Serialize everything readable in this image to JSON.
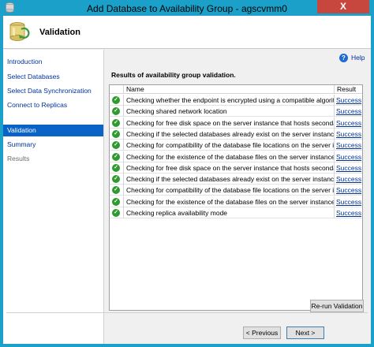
{
  "window": {
    "title": "Add Database to Availability Group - agscvmm0",
    "close_glyph": "X"
  },
  "header": {
    "title": "Validation"
  },
  "sidebar": {
    "items": [
      {
        "label": "Introduction",
        "state": "normal"
      },
      {
        "label": "Select Databases",
        "state": "normal"
      },
      {
        "label": "Select Data Synchronization",
        "state": "normal"
      },
      {
        "label": "Connect to Replicas",
        "state": "normal"
      },
      {
        "label": "Validation",
        "state": "active"
      },
      {
        "label": "Summary",
        "state": "normal"
      },
      {
        "label": "Results",
        "state": "disabled"
      }
    ]
  },
  "help": {
    "label": "Help",
    "glyph": "?"
  },
  "main": {
    "results_label": "Results of availability group validation.",
    "columns": {
      "name": "Name",
      "result": "Result"
    },
    "rows": [
      {
        "name": "Checking whether the endpoint is encrypted using a compatible algorithm",
        "result": "Success"
      },
      {
        "name": "Checking shared network location",
        "result": "Success"
      },
      {
        "name": "Checking for free disk space on the server instance that hosts secondary re...",
        "result": "Success"
      },
      {
        "name": "Checking if the selected databases already exist on the server instance that ...",
        "result": "Success"
      },
      {
        "name": "Checking for compatibility of the database file locations on the server insta...",
        "result": "Success"
      },
      {
        "name": "Checking for the existence of the database files on the server instance that ...",
        "result": "Success"
      },
      {
        "name": "Checking for free disk space on the server instance that hosts secondary re...",
        "result": "Success"
      },
      {
        "name": "Checking if the selected databases already exist on the server instance that ...",
        "result": "Success"
      },
      {
        "name": "Checking for compatibility of the database file locations on the server insta...",
        "result": "Success"
      },
      {
        "name": "Checking for the existence of the database files on the server instance that ...",
        "result": "Success"
      },
      {
        "name": "Checking replica availability mode",
        "result": "Success"
      }
    ],
    "status_icon": "check-circle-icon",
    "rerun_label": "Re-run Validation"
  },
  "footer": {
    "previous_label": "< Previous",
    "next_label": "Next >"
  },
  "colors": {
    "accent": "#1ba1c9",
    "selection": "#0a64c8",
    "link": "#003399",
    "success_icon": "#2f9a2f",
    "close": "#c7463e"
  }
}
